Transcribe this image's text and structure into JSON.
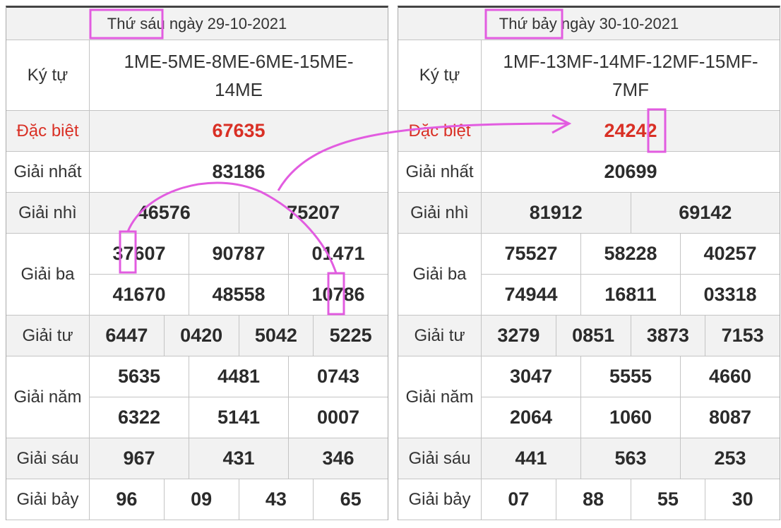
{
  "tables": [
    {
      "date_header": "Thứ sáu ngày 29-10-2021",
      "ky_tu_label": "Ký tự",
      "ky_tu": "1ME-5ME-8ME-6ME-15ME-14ME",
      "dac_biet_label": "Đặc biệt",
      "dac_biet": "67635",
      "giai_nhat_label": "Giải nhất",
      "giai_nhat": "83186",
      "giai_nhi_label": "Giải nhì",
      "giai_nhi": [
        "46576",
        "75207"
      ],
      "giai_ba_label": "Giải ba",
      "giai_ba": [
        "37607",
        "90787",
        "01471",
        "41670",
        "48558",
        "10786"
      ],
      "giai_tu_label": "Giải tư",
      "giai_tu": [
        "6447",
        "0420",
        "5042",
        "5225"
      ],
      "giai_nam_label": "Giải năm",
      "giai_nam": [
        "5635",
        "4481",
        "0743",
        "6322",
        "5141",
        "0007"
      ],
      "giai_sau_label": "Giải sáu",
      "giai_sau": [
        "967",
        "431",
        "346"
      ],
      "giai_bay_label": "Giải bảy",
      "giai_bay": [
        "96",
        "09",
        "43",
        "65"
      ]
    },
    {
      "date_header": "Thứ bảy ngày 30-10-2021",
      "ky_tu_label": "Ký tự",
      "ky_tu": "1MF-13MF-14MF-12MF-15MF-7MF",
      "dac_biet_label": "Đặc biệt",
      "dac_biet": "24242",
      "giai_nhat_label": "Giải nhất",
      "giai_nhat": "20699",
      "giai_nhi_label": "Giải nhì",
      "giai_nhi": [
        "81912",
        "69142"
      ],
      "giai_ba_label": "Giải ba",
      "giai_ba": [
        "75527",
        "58228",
        "40257",
        "74944",
        "16811",
        "03318"
      ],
      "giai_tu_label": "Giải tư",
      "giai_tu": [
        "3279",
        "0851",
        "3873",
        "7153"
      ],
      "giai_nam_label": "Giải năm",
      "giai_nam": [
        "3047",
        "5555",
        "4660",
        "2064",
        "1060",
        "8087"
      ],
      "giai_sau_label": "Giải sáu",
      "giai_sau": [
        "441",
        "563",
        "253"
      ],
      "giai_bay_label": "Giải bảy",
      "giai_bay": [
        "07",
        "88",
        "55",
        "30"
      ]
    }
  ],
  "colors": {
    "annotation": "#e25ce0",
    "special_prize": "#d93025"
  }
}
